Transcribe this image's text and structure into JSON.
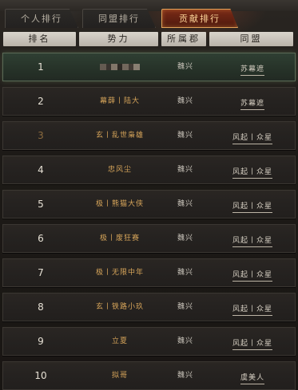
{
  "tabs": [
    {
      "label": "个人排行",
      "active": false
    },
    {
      "label": "同盟排行",
      "active": false
    },
    {
      "label": "贡献排行",
      "active": true
    }
  ],
  "columns": {
    "rank": "排名",
    "faction": "势力",
    "county": "所属郡",
    "alliance": "同盟"
  },
  "rows": [
    {
      "rank": "1",
      "faction": "",
      "county": "魏兴",
      "alliance": "苏幕遮"
    },
    {
      "rank": "2",
      "faction": "幕薛丨陆大",
      "county": "魏兴",
      "alliance": "苏幕遮"
    },
    {
      "rank": "3",
      "faction": "玄丨乱世枭雄",
      "county": "魏兴",
      "alliance": "风起丨众星"
    },
    {
      "rank": "4",
      "faction": "忠风尘",
      "county": "魏兴",
      "alliance": "风起丨众星"
    },
    {
      "rank": "5",
      "faction": "极丨熊猫大侠",
      "county": "魏兴",
      "alliance": "风起丨众星"
    },
    {
      "rank": "6",
      "faction": "极丨废狂赛",
      "county": "魏兴",
      "alliance": "风起丨众星"
    },
    {
      "rank": "7",
      "faction": "极丨无限中年",
      "county": "魏兴",
      "alliance": "风起丨众星"
    },
    {
      "rank": "8",
      "faction": "玄丨铁路小玖",
      "county": "魏兴",
      "alliance": "风起丨众星"
    },
    {
      "rank": "9",
      "faction": "立夏",
      "county": "魏兴",
      "alliance": "风起丨众星"
    },
    {
      "rank": "10",
      "faction": "拟哥",
      "county": "魏兴",
      "alliance": "虞美人"
    }
  ]
}
